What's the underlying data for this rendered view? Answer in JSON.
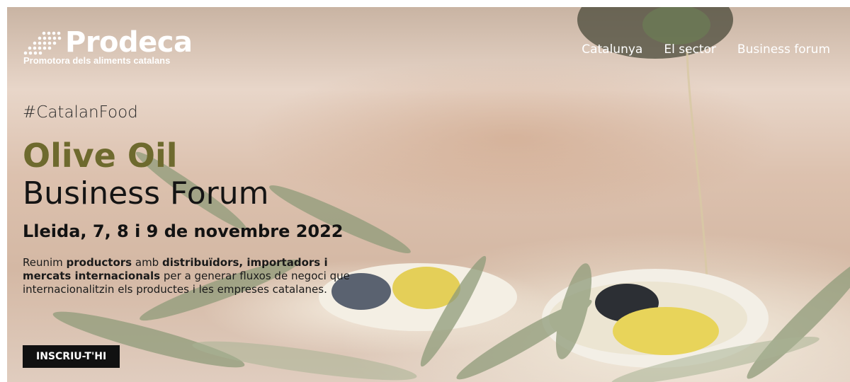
{
  "brand": {
    "name": "Prodeca",
    "tagline": "Promotora dels aliments catalans",
    "logo_icon": "dots-logo-icon"
  },
  "nav": {
    "items": [
      {
        "label": "Catalunya"
      },
      {
        "label": "El sector"
      },
      {
        "label": "Business forum"
      }
    ]
  },
  "hero": {
    "hashtag": "#CatalanFood",
    "title_accent": "Olive Oil",
    "title_main": "Business Forum",
    "subtitle": "Lleida, 7, 8 i 9 de novembre 2022",
    "description": {
      "t1": "Reunim ",
      "b1": "productors",
      "t2": " amb ",
      "b2": "distribuïdors, importadors i mercats internacionals",
      "t3": " per a generar fluxos de negoci que internacionalitzin els productes i les empreses catalanes."
    },
    "cta_label": "INSCRIU-T'HI"
  },
  "colors": {
    "accent": "#6e6a2e",
    "cta_bg": "#111111",
    "nav_text": "#ffffff"
  }
}
